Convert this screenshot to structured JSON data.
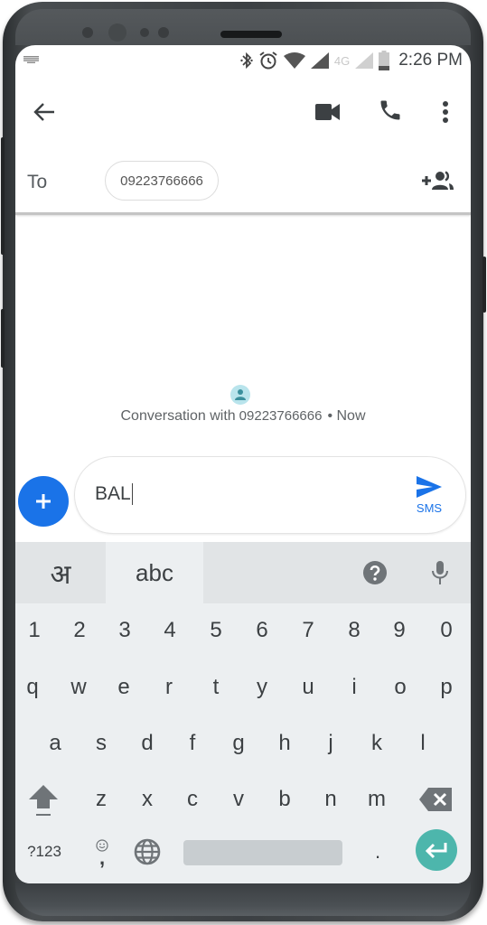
{
  "status_bar": {
    "time": "2:26 PM",
    "network_label": "4G",
    "icons": [
      "keyboard-icon",
      "bluetooth-icon",
      "alarm-icon",
      "wifi-icon",
      "signal-icon",
      "signal-secondary-icon",
      "battery-icon"
    ]
  },
  "app_bar": {
    "back_icon": "arrow-back-icon",
    "actions": [
      "video-call-icon",
      "phone-icon",
      "more-vert-icon"
    ]
  },
  "recipient": {
    "label": "To",
    "chip": "09223766666",
    "add_icon": "add-people-icon"
  },
  "conversation": {
    "prefix": "Conversation with",
    "contact": "09223766666",
    "time": "• Now"
  },
  "compose": {
    "value": "BAL",
    "send_label": "SMS",
    "accent": "#1a73e8"
  },
  "keyboard": {
    "lang_hindi": "अ",
    "lang_abc": "abc",
    "number_row": [
      "1",
      "2",
      "3",
      "4",
      "5",
      "6",
      "7",
      "8",
      "9",
      "0"
    ],
    "row1": [
      "q",
      "w",
      "e",
      "r",
      "t",
      "y",
      "u",
      "i",
      "o",
      "p"
    ],
    "row2": [
      "a",
      "s",
      "d",
      "f",
      "g",
      "h",
      "j",
      "k",
      "l"
    ],
    "row3": [
      "z",
      "x",
      "c",
      "v",
      "b",
      "n",
      "m"
    ],
    "symbols_label": "?123",
    "comma_label": ",",
    "period_label": ".",
    "enter_color": "#4db6ac"
  }
}
